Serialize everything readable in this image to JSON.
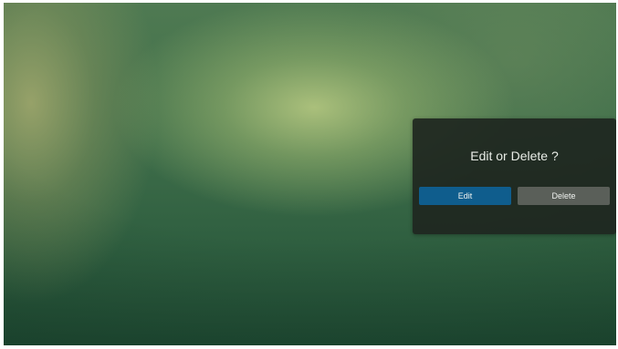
{
  "dialog": {
    "title": "Edit or Delete ?",
    "buttons": {
      "edit_label": "Edit",
      "delete_label": "Delete"
    }
  },
  "colors": {
    "edit_button": "#0f5d8d",
    "delete_button": "#5a5f59",
    "dialog_background": "#1e2620"
  }
}
